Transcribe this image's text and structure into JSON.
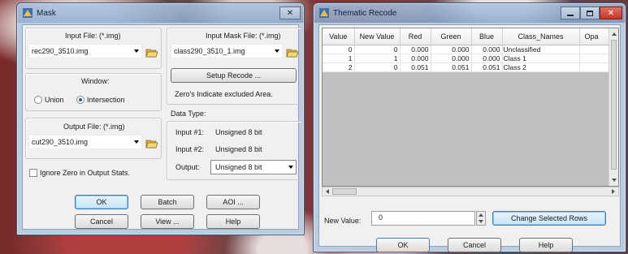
{
  "mask_dialog": {
    "title": "Mask",
    "close_glyph": "✕",
    "input_file": {
      "label": "Input File: (*.img)",
      "value": "rec290_3510.img"
    },
    "input_mask_file": {
      "label": "Input Mask File: (*.img)",
      "value": "class290_3510_1.img"
    },
    "setup_recode_label": "Setup Recode ...",
    "zero_note": "Zero's Indicate excluded Area.",
    "window": {
      "label": "Window:",
      "union_label": "Union",
      "intersection_label": "Intersection",
      "selected": "Intersection"
    },
    "data_type": {
      "label": "Data Type:",
      "input1_label": "Input #1:",
      "input1_value": "Unsigned 8 bit",
      "input2_label": "Input #2:",
      "input2_value": "Unsigned 8 bit",
      "output_label": "Output:",
      "output_value": "Unsigned 8 bit"
    },
    "output_file": {
      "label": "Output File: (*.img)",
      "value": "cut290_3510.img"
    },
    "ignore_zero_label": "Ignore Zero in Output Stats.",
    "buttons": {
      "ok": "OK",
      "batch": "Batch",
      "aoi": "AOI ...",
      "cancel": "Cancel",
      "view": "View ...",
      "help": "Help"
    }
  },
  "recode_dialog": {
    "title": "Thematic Recode",
    "columns": [
      "Value",
      "New Value",
      "Red",
      "Green",
      "Blue",
      "Class_Names",
      "Opa"
    ],
    "rows": [
      [
        "0",
        "0",
        "0.000",
        "0.000",
        "0.000",
        "Unclassified"
      ],
      [
        "1",
        "1",
        "0.000",
        "0.000",
        "0.000",
        "Class 1"
      ],
      [
        "2",
        "0",
        "0.051",
        "0.051",
        "0.051",
        "Class 2"
      ]
    ],
    "new_value_label": "New Value:",
    "new_value": "0",
    "change_rows_label": "Change Selected Rows",
    "buttons": {
      "ok": "OK",
      "cancel": "Cancel",
      "help": "Help"
    }
  },
  "colors": {
    "accent": "#3c7fb1",
    "grid_bg": "#c0c0c0",
    "close_red": "#c8352a"
  }
}
